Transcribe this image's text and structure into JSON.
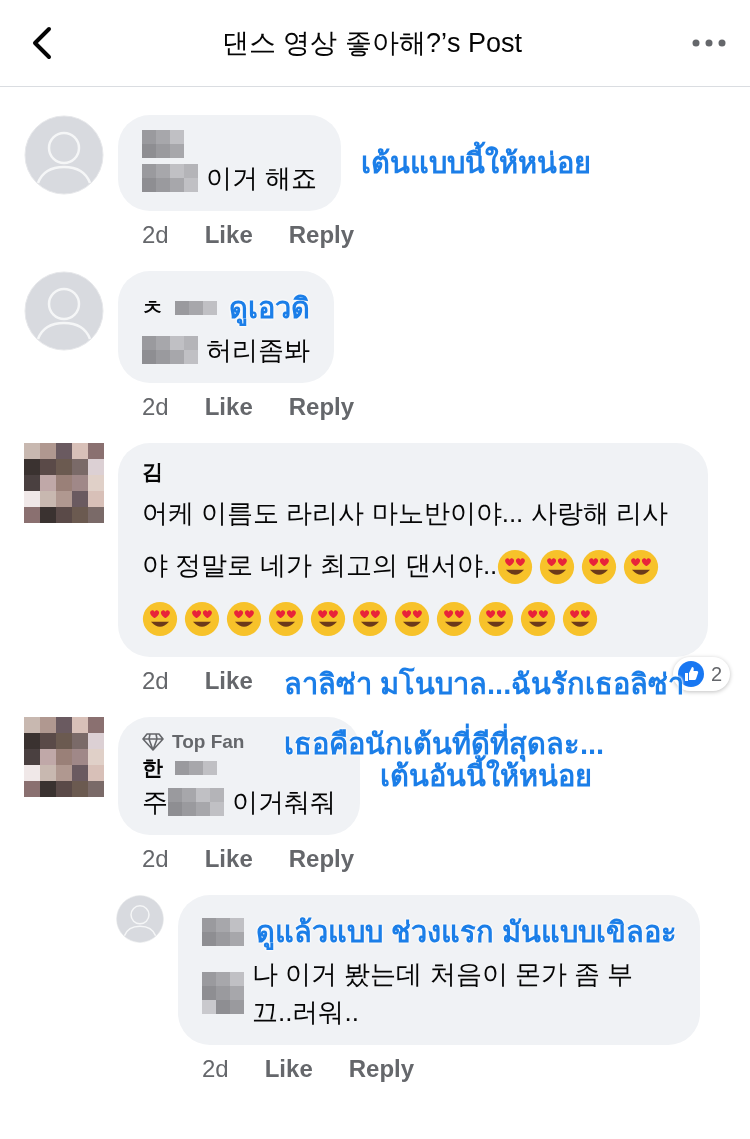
{
  "header": {
    "title": "댄스 영상 좋아해?’s Post"
  },
  "comments": [
    {
      "avatar": {
        "kind": "silhouette"
      },
      "body": "이거 해죠",
      "body_prefix_blur": true,
      "time": "2d",
      "actions": [
        "Like",
        "Reply"
      ],
      "annotation": {
        "kind": "beside",
        "lines": [
          "เต้นแบบนี้ให้หน่อย"
        ]
      }
    },
    {
      "avatar": {
        "kind": "silhouette"
      },
      "name": "ㅊ",
      "body": "허리좀봐",
      "body_prefix_blur": true,
      "time": "2d",
      "actions": [
        "Like",
        "Reply"
      ],
      "annotation": {
        "kind": "name_line",
        "lines": [
          "ดูเอวดิ"
        ]
      }
    },
    {
      "avatar": {
        "kind": "pixelated"
      },
      "name": "김",
      "body": "어케 이름도 라리사 마노반이야... 사랑해 리사야 정말로 네가 최고의 댄서야..",
      "emojis": [
        {
          "kind": "heart_eyes"
        },
        {
          "kind": "heart_eyes"
        },
        {
          "kind": "heart_eyes"
        },
        {
          "kind": "heart_eyes"
        },
        {
          "kind": "heart_eyes"
        },
        {
          "kind": "heart_eyes"
        },
        {
          "kind": "heart_eyes"
        },
        {
          "kind": "heart_eyes"
        },
        {
          "kind": "heart_eyes"
        },
        {
          "kind": "heart_eyes"
        },
        {
          "kind": "heart_eyes"
        },
        {
          "kind": "heart_eyes"
        },
        {
          "kind": "heart_eyes"
        },
        {
          "kind": "heart_eyes"
        },
        {
          "kind": "heart_eyes"
        }
      ],
      "reaction": {
        "count": "2"
      },
      "time": "2d",
      "actions": [
        "Like"
      ],
      "annotation": {
        "kind": "below",
        "lines": [
          "ลาลิซ่า  มโนบาล...ฉันรักเธอลิซ่า",
          "เธอคือนักเต้นที่ดีที่สุดละ..."
        ]
      }
    },
    {
      "avatar": {
        "kind": "pixelated"
      },
      "name": "한",
      "badge": "Top Fan",
      "body_start": "주",
      "body": "이거춰줘",
      "body_prefix_blur": true,
      "time": "2d",
      "actions": [
        "Like",
        "Reply"
      ],
      "annotation": {
        "kind": "beside",
        "lines": [
          "เต้นอันนี้ให้หน่อย"
        ]
      },
      "replies": [
        {
          "avatar": {
            "kind": "silhouette"
          },
          "body": "나 이거 봤는데 처음이 몬가 좀 부끄..러워..",
          "body_prefix_blur": true,
          "time": "2d",
          "actions": [
            "Like",
            "Reply"
          ],
          "annotation": {
            "kind": "name_line",
            "lines": [
              "ดูแล้วแบบ  ช่วงแรก  มันแบบเขิลอะ"
            ]
          }
        }
      ]
    }
  ]
}
